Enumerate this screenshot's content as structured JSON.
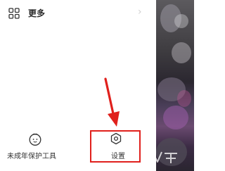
{
  "drawer": {
    "more": {
      "label": "更多",
      "icon": "grid-icon",
      "chevron": "›"
    },
    "bottom": {
      "minor_tools": {
        "label": "未成年保护工具",
        "icon": "minor-protection-icon"
      },
      "settings": {
        "label": "设置",
        "icon": "settings-gear-icon"
      }
    }
  },
  "annotation": {
    "arrow_color": "#e0201c",
    "box_color": "#e0201c"
  }
}
